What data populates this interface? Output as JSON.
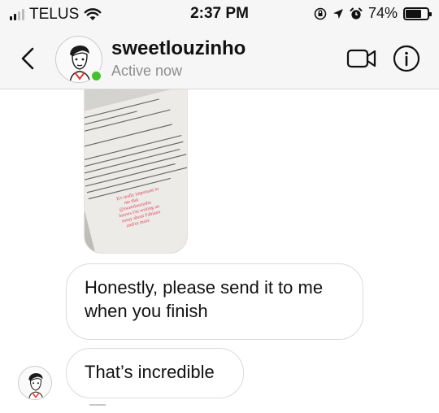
{
  "status_bar": {
    "carrier": "TELUS",
    "time": "2:37 PM",
    "battery": "74%",
    "battery_level": 0.74,
    "signal_bars": 4,
    "signal_filled": 2
  },
  "header": {
    "username": "sweetlouzinho",
    "status": "Active now",
    "icons": [
      "back-chevron-icon",
      "video-call-icon",
      "info-icon"
    ]
  },
  "messages": [
    {
      "type": "photo",
      "caption_lines": [
        "It's really important to",
        "me that",
        "@sweetlouzinho",
        "knows I'm writing an",
        "essay about Fabiana",
        "and/or more"
      ]
    },
    {
      "type": "text",
      "text": "Honestly, please send it to me when you finish"
    },
    {
      "type": "text",
      "text": "That’s incredible"
    }
  ],
  "colors": {
    "online": "#44c12f",
    "bubble_border": "#dbdbdb",
    "header_bg": "#f6f6f6",
    "muted_text": "#8e8e8e",
    "photo_highlight": "#e0435a"
  }
}
